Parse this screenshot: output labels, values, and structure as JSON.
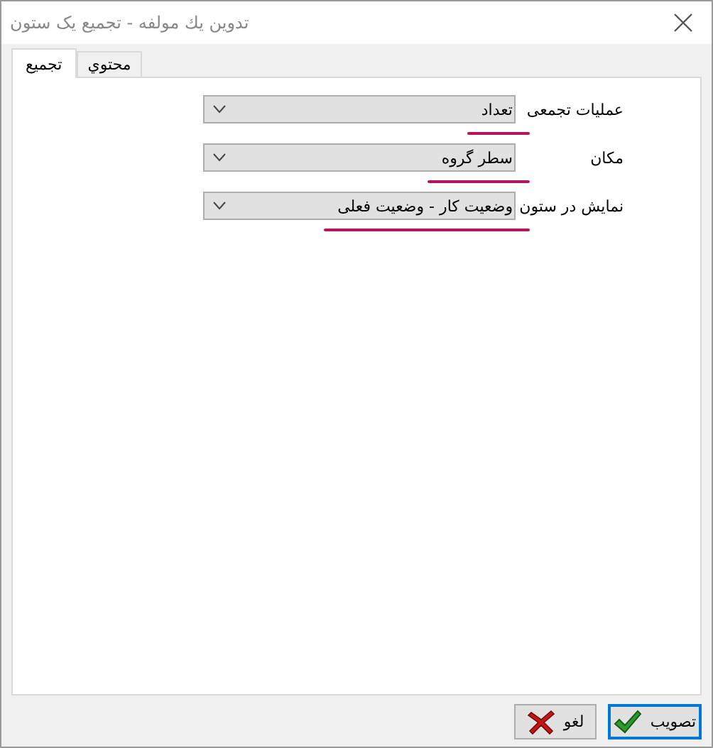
{
  "window": {
    "title": "تدوين يك مولفه - تجميع يک ستون"
  },
  "tabs": [
    {
      "label": "محتوي",
      "selected": false
    },
    {
      "label": "تجميع",
      "selected": true
    }
  ],
  "fields": [
    {
      "label": "عمليات تجمعی",
      "value": "تعداد",
      "underlined": true
    },
    {
      "label": "مکان",
      "value": "سطر گروه",
      "underlined": true
    },
    {
      "label": "نمايش در ستون",
      "value": "وضعيت کار - وضعيت فعلی",
      "underlined": true
    }
  ],
  "buttons": [
    {
      "label": "تصويب",
      "kind": "ok",
      "selected": true
    },
    {
      "label": "لغو",
      "kind": "cancel",
      "selected": false
    }
  ]
}
